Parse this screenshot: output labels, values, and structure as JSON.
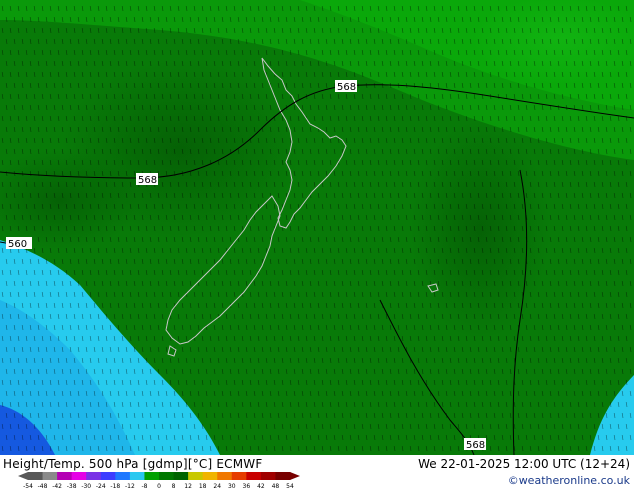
{
  "map": {
    "contour_labels": [
      "568",
      "568",
      "560",
      "568"
    ],
    "colors": {
      "green_light": "#0aa80a",
      "green_mid": "#087a08",
      "green_dark": "#056005",
      "cyan": "#27cbee",
      "cyan_light": "#5ad8f4",
      "blue_dark": "#1559e0",
      "coast": "#c8c8c8"
    }
  },
  "footer": {
    "title_left": "Height/Temp. 500 hPa [gdmp][°C] ECMWF",
    "title_right": "We 22-01-2025 12:00 UTC (12+24)",
    "credit": "©weatheronline.co.uk"
  },
  "colorbar": {
    "ticks": [
      "-54",
      "-48",
      "-42",
      "-38",
      "-30",
      "-24",
      "-18",
      "-12",
      "-8",
      "0",
      "8",
      "12",
      "18",
      "24",
      "30",
      "36",
      "42",
      "48",
      "54"
    ],
    "colors": [
      "#585858",
      "#8a8a8a",
      "#b400b4",
      "#e600e6",
      "#7a32e6",
      "#3c3cff",
      "#1e78ff",
      "#29c8f0",
      "#00a000",
      "#007800",
      "#006400",
      "#c8c800",
      "#f0b400",
      "#f07800",
      "#e63c00",
      "#c80000",
      "#a00000",
      "#780000"
    ]
  }
}
